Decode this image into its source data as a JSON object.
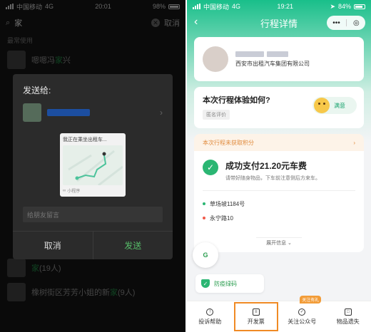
{
  "left": {
    "status": {
      "carrier": "中国移动",
      "network": "4G",
      "time": "20:01",
      "battery": "98%"
    },
    "search": {
      "query": "家",
      "cancel_label": "取消"
    },
    "section_label": "最常使用",
    "chats": [
      {
        "name_prefix": "嗯嗯冯",
        "name_highlight": "家",
        "name_suffix": "兴"
      }
    ],
    "dialog": {
      "title": "发送给:",
      "card_title": "我正在乘坐出租车...",
      "card_badge": "小程序",
      "message_placeholder": "给朋友留言",
      "cancel_label": "取消",
      "send_label": "发送"
    },
    "bottom_chats": [
      {
        "name_prefix": "",
        "name_highlight": "家",
        "name_suffix": "(19人)"
      },
      {
        "name_prefix": "橡树街区芳芳小姐的新",
        "name_highlight": "家",
        "name_suffix": "(9人)"
      }
    ]
  },
  "right": {
    "status": {
      "carrier": "中国移动",
      "network": "4G",
      "time": "19:21",
      "battery": "84%"
    },
    "title": "行程详情",
    "capsule_more": "•••",
    "driver_company": "西安市出租汽车集团有限公司",
    "rating": {
      "question": "本次行程体验如何?",
      "anon_label": "匿名评价",
      "emoji_label": "满意"
    },
    "points_text": "本次行程未获取积分",
    "payment": {
      "title": "成功支付21.20元车费",
      "subtitle": "请带好随身物品，下车前注意侧后方来车。",
      "start": "草场坡1184号",
      "end": "永宁路10",
      "expand_label": "展开信息"
    },
    "health_code_label": "防疫绿码",
    "tabs": [
      {
        "label": "投诉帮助",
        "icon": "!"
      },
      {
        "label": "开发票",
        "icon": "≡"
      },
      {
        "label": "关注公众号",
        "icon": "✓",
        "badge": "关注有礼"
      },
      {
        "label": "物品遗失",
        "icon": "□"
      }
    ],
    "colors": {
      "brand": "#19bf8a",
      "accent": "#f08a24",
      "success": "#2bb673"
    }
  }
}
